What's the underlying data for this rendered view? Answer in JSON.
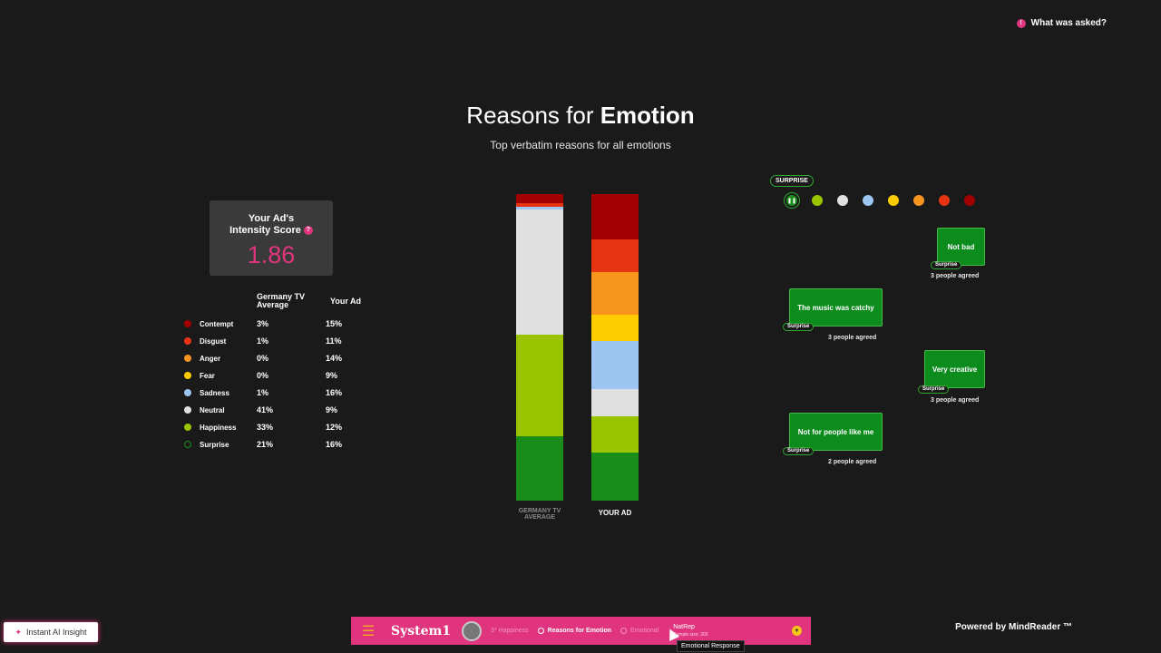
{
  "header": {
    "what_asked": "What was asked?",
    "title_plain": "Reasons for ",
    "title_bold": "Emotion",
    "subtitle": "Top verbatim reasons for all emotions"
  },
  "score_card": {
    "label_line1": "Your Ad's",
    "label_line2": "Intensity Score",
    "help": "?",
    "value": "1.86"
  },
  "table": {
    "col1_header": "Germany TV Average",
    "col2_header": "Your Ad",
    "rows": [
      {
        "name": "Contempt",
        "avg": "3%",
        "ad": "15%",
        "color": "#a00000"
      },
      {
        "name": "Disgust",
        "avg": "1%",
        "ad": "11%",
        "color": "#e63312"
      },
      {
        "name": "Anger",
        "avg": "0%",
        "ad": "14%",
        "color": "#f7941d"
      },
      {
        "name": "Fear",
        "avg": "0%",
        "ad": "9%",
        "color": "#ffcc00"
      },
      {
        "name": "Sadness",
        "avg": "1%",
        "ad": "16%",
        "color": "#9cc5f2"
      },
      {
        "name": "Neutral",
        "avg": "41%",
        "ad": "9%",
        "color": "#e0e0e0"
      },
      {
        "name": "Happiness",
        "avg": "33%",
        "ad": "12%",
        "color": "#9bc400"
      },
      {
        "name": "Surprise",
        "avg": "21%",
        "ad": "16%",
        "color": "#1a8c1a"
      }
    ]
  },
  "bars": {
    "avg_label": "GERMANY TV AVERAGE",
    "ad_label": "YOUR AD"
  },
  "verbatims": {
    "active_filter": "SURPRISE",
    "filter_dots": [
      {
        "emotion": "surprise",
        "color": "#1a8c1a"
      },
      {
        "emotion": "happiness",
        "color": "#9bc400"
      },
      {
        "emotion": "neutral",
        "color": "#e0e0e0"
      },
      {
        "emotion": "sadness",
        "color": "#9cc5f2"
      },
      {
        "emotion": "fear",
        "color": "#ffcc00"
      },
      {
        "emotion": "anger",
        "color": "#f7941d"
      },
      {
        "emotion": "disgust",
        "color": "#e63312"
      },
      {
        "emotion": "contempt",
        "color": "#a00000"
      }
    ],
    "items": [
      {
        "text": "Not bad",
        "tag": "Surprise",
        "agreed": "3 people agreed"
      },
      {
        "text": "The music was catchy",
        "tag": "Surprise",
        "agreed": "3 people agreed"
      },
      {
        "text": "Very creative",
        "tag": "Surprise",
        "agreed": "3 people agreed"
      },
      {
        "text": "Not for people like me",
        "tag": "Surprise",
        "agreed": "2 people agreed"
      }
    ]
  },
  "footer": {
    "ai_insight": "Instant AI Insight",
    "brand": "System1",
    "nav_happiness": "3* Happiness",
    "nav_reasons": "Reasons for Emotion",
    "nav_emotional": "Emotional",
    "sample_title": "NatRep",
    "sample_size": "Sample size: 200",
    "tooltip": "Emotional Response",
    "powered_by": "Powered by MindReader ™"
  },
  "chart_data": [
    {
      "type": "bar",
      "title": "",
      "categories": [
        "GERMANY TV AVERAGE",
        "YOUR AD"
      ],
      "series": [
        {
          "name": "Contempt",
          "values": [
            3,
            15
          ],
          "color": "#a00000"
        },
        {
          "name": "Disgust",
          "values": [
            1,
            11
          ],
          "color": "#e63312"
        },
        {
          "name": "Anger",
          "values": [
            0,
            14
          ],
          "color": "#f7941d"
        },
        {
          "name": "Fear",
          "values": [
            0,
            9
          ],
          "color": "#ffcc00"
        },
        {
          "name": "Sadness",
          "values": [
            1,
            16
          ],
          "color": "#9cc5f2"
        },
        {
          "name": "Neutral",
          "values": [
            41,
            9
          ],
          "color": "#e0e0e0"
        },
        {
          "name": "Happiness",
          "values": [
            33,
            12
          ],
          "color": "#9bc400"
        },
        {
          "name": "Surprise",
          "values": [
            21,
            16
          ],
          "color": "#1a8c1a"
        }
      ],
      "stacked": true,
      "ylim": [
        0,
        100
      ]
    }
  ]
}
